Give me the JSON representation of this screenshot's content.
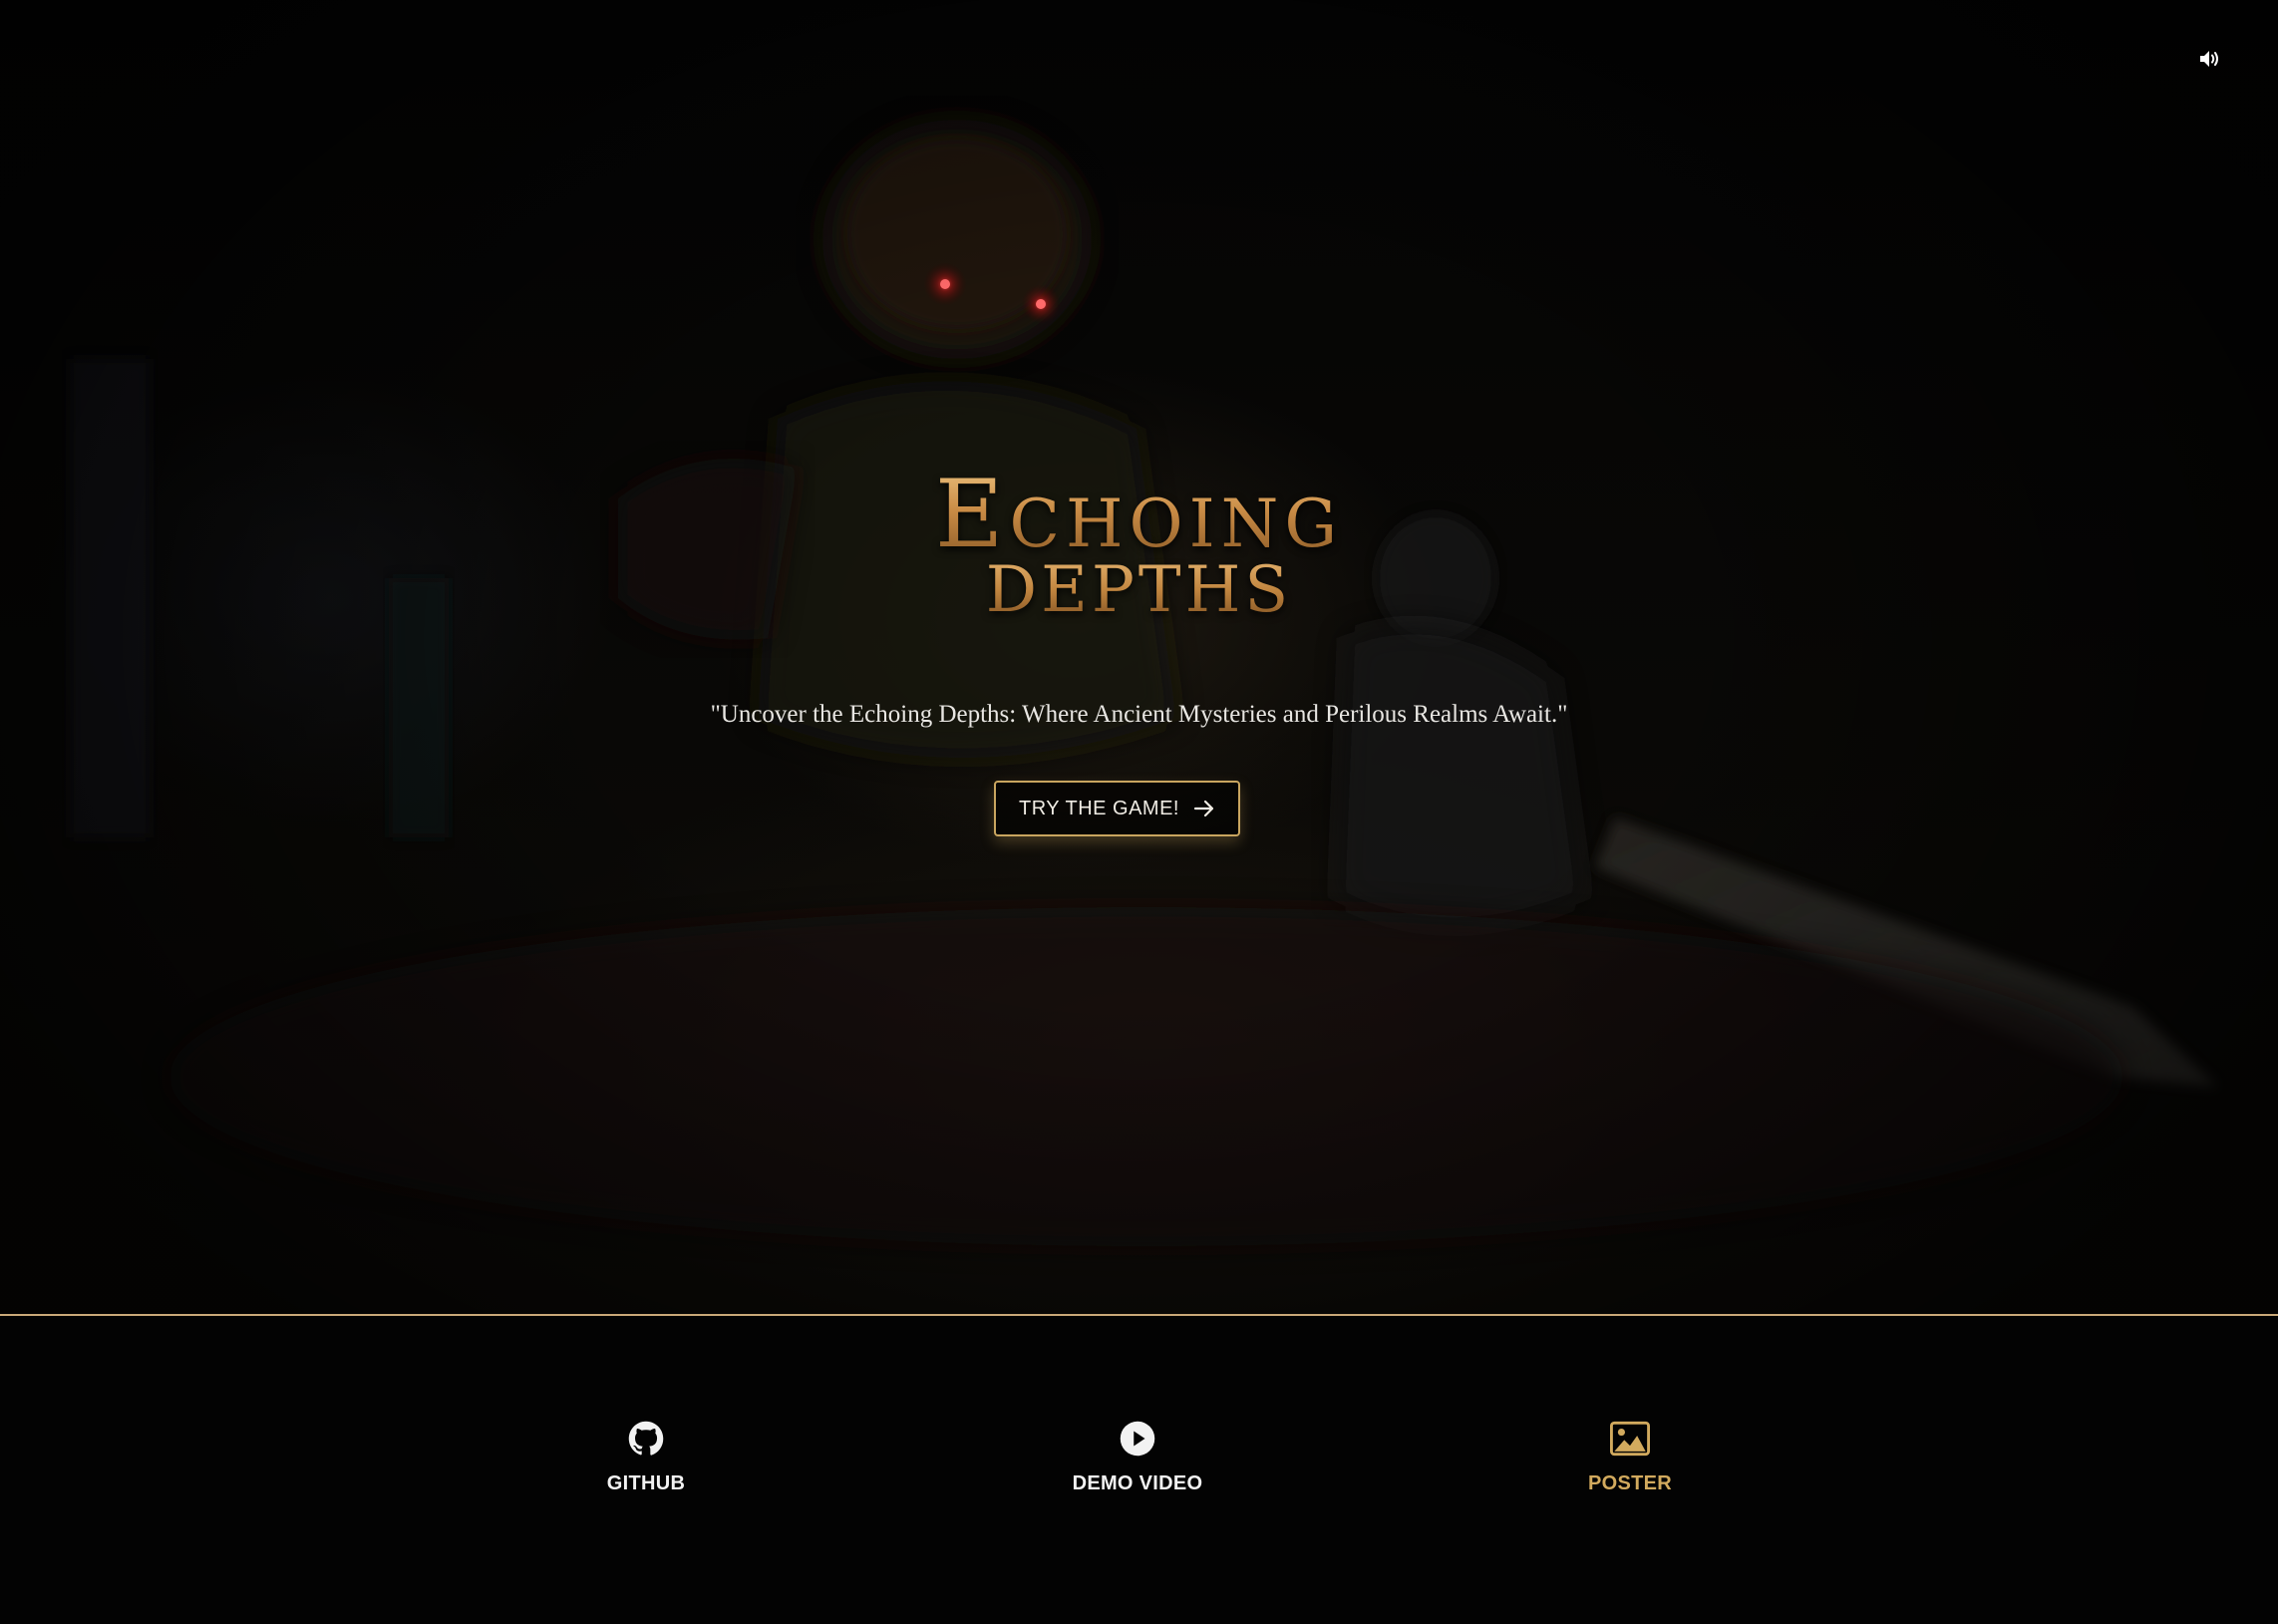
{
  "hero": {
    "logo_main": "Echoing",
    "logo_sub": "DEPTHS",
    "tagline": "\"Uncover the Echoing Depths: Where Ancient Mysteries and Perilous Realms Await.\"",
    "cta_label": "TRY THE GAME!",
    "sound_icon": "speaker-volume-icon"
  },
  "footer": {
    "links": [
      {
        "label": "GITHUB",
        "icon": "github-icon"
      },
      {
        "label": "DEMO VIDEO",
        "icon": "play-circle-icon"
      },
      {
        "label": "POSTER",
        "icon": "image-icon",
        "active": true
      }
    ]
  },
  "colors": {
    "accent_gold": "#c9a55f",
    "active_link": "#d2aa5e",
    "divider": "#c9a878",
    "background": "#030303"
  }
}
